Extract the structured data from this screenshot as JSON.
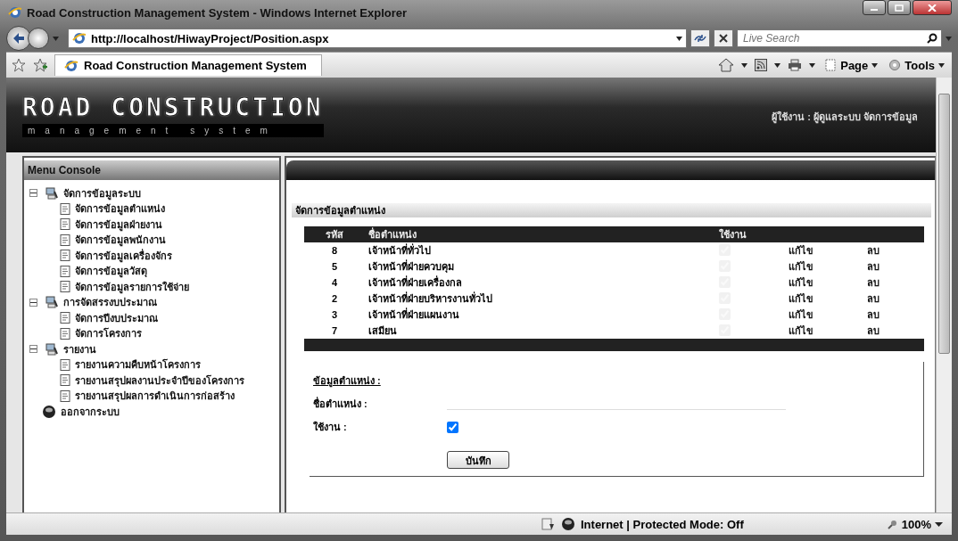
{
  "window": {
    "title": "Road Construction Management System - Windows Internet Explorer"
  },
  "address_bar": {
    "url": "http://localhost/HiwayProject/Position.aspx"
  },
  "search": {
    "placeholder": "Live Search"
  },
  "favorites_tab": {
    "label": "Road Construction Management System"
  },
  "command_bar": {
    "buttons": [
      "Page",
      "Tools"
    ]
  },
  "header": {
    "logo_title": "ROAD CONSTRUCTION",
    "logo_subtitle": "management system",
    "user": "ผู้ใช้งาน : ผู้ดูแลระบบ จัดการข้อมูล"
  },
  "sidebar": {
    "title": "Menu Console",
    "items": [
      {
        "label": "จัดการข้อมูลระบบ",
        "expanded": true,
        "children": [
          {
            "label": "จัดการข้อมูลตำแหน่ง"
          },
          {
            "label": "จัดการข้อมูลฝ่ายงาน"
          },
          {
            "label": "จัดการข้อมูลพนักงาน"
          },
          {
            "label": "จัดการข้อมูลเครื่องจักร"
          },
          {
            "label": "จัดการข้อมูลวัสดุ"
          },
          {
            "label": "จัดการข้อมูลรายการใช้จ่าย"
          }
        ]
      },
      {
        "label": "การจัดสรรงบประมาณ",
        "expanded": true,
        "children": [
          {
            "label": "จัดการปีงบประมาณ"
          },
          {
            "label": "จัดการโครงการ"
          }
        ]
      },
      {
        "label": "รายงาน",
        "expanded": true,
        "children": [
          {
            "label": "รายงานความคืบหน้าโครงการ"
          },
          {
            "label": "รายงานสรุปผลงานประจำปีของโครงการ"
          },
          {
            "label": "รายงานสรุปผลการดำเนินการก่อสร้าง"
          }
        ]
      },
      {
        "label": "ออกจากระบบ",
        "kind": "logout"
      }
    ]
  },
  "panel": {
    "title": "จัดการข้อมูลตำแหน่ง",
    "table": {
      "columns": [
        "รหัส",
        "ชื่อตำแหน่ง",
        "ใช้งาน"
      ],
      "rows": [
        {
          "id": "8",
          "name": "เจ้าหน้าที่ทั่วไป",
          "checked": true,
          "disabled": true,
          "edit": "แก้ไข",
          "delete": "ลบ"
        },
        {
          "id": "5",
          "name": "เจ้าหน้าที่ฝ่ายควบคุม",
          "checked": true,
          "disabled": true,
          "edit": "แก้ไข",
          "delete": "ลบ"
        },
        {
          "id": "4",
          "name": "เจ้าหน้าที่ฝ่ายเครื่องกล",
          "checked": true,
          "disabled": true,
          "edit": "แก้ไข",
          "delete": "ลบ"
        },
        {
          "id": "2",
          "name": "เจ้าหน้าที่ฝ่ายบริหารงานทั่วไป",
          "checked": true,
          "disabled": true,
          "edit": "แก้ไข",
          "delete": "ลบ"
        },
        {
          "id": "3",
          "name": "เจ้าหน้าที่ฝ่ายแผนงาน",
          "checked": true,
          "disabled": true,
          "edit": "แก้ไข",
          "delete": "ลบ"
        },
        {
          "id": "7",
          "name": "เสมียน",
          "checked": true,
          "disabled": true,
          "edit": "แก้ไข",
          "delete": "ลบ"
        }
      ]
    }
  },
  "form": {
    "title": "ข้อมูลตำแหน่ง :",
    "fields": [
      {
        "kind": "text",
        "label": "ชื่อตำแหน่ง :"
      },
      {
        "kind": "checkbox",
        "label": "ใช้งาน :",
        "checked": true
      }
    ],
    "button": "บันทึก"
  },
  "status_bar": {
    "zone": "Internet | Protected Mode: Off",
    "zoom": "100%"
  }
}
